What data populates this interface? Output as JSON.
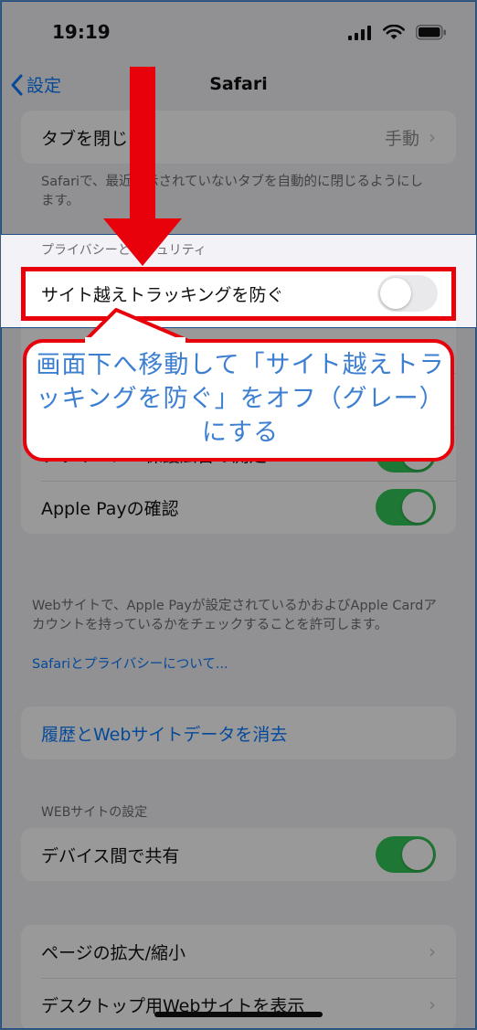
{
  "status_bar": {
    "time": "19:19"
  },
  "nav": {
    "back_label": "設定",
    "title": "Safari"
  },
  "tabs_section": {
    "close_tabs_label": "タブを閉じる",
    "close_tabs_value": "手動",
    "note": "Safariで、最近表示されていないタブを自動的に閉じるようにします。"
  },
  "privacy_section": {
    "header": "プライバシーとセキュリティ",
    "cross_site_tracking_label": "サイト越えトラッキングを防ぐ",
    "cross_site_tracking_on": false,
    "privacy_ad_label": "プライバシー保護広告の測定",
    "privacy_ad_on": true,
    "apple_pay_label": "Apple Payの確認",
    "apple_pay_on": true,
    "note": "Webサイトで、Apple Payが設定されているかおよびApple Cardアカウントを持っているかをチェックすることを許可します。",
    "about_link": "Safariとプライバシーについて..."
  },
  "history": {
    "clear_label": "履歴とWebサイトデータを消去"
  },
  "website_settings": {
    "header": "WEBサイトの設定",
    "share_across_devices_label": "デバイス間で共有",
    "share_across_devices_on": true,
    "page_zoom_label": "ページの拡大/縮小",
    "desktop_site_label": "デスクトップ用Webサイトを表示"
  },
  "annotation": {
    "callout_text": "画面下へ移動して「サイト越えトラッキングを防ぐ」をオフ（グレー）にする"
  },
  "colors": {
    "accent": "#0a7aff",
    "toggle_on": "#34c759",
    "annotation_red": "#e8000b",
    "callout_text": "#3c7fd1"
  }
}
